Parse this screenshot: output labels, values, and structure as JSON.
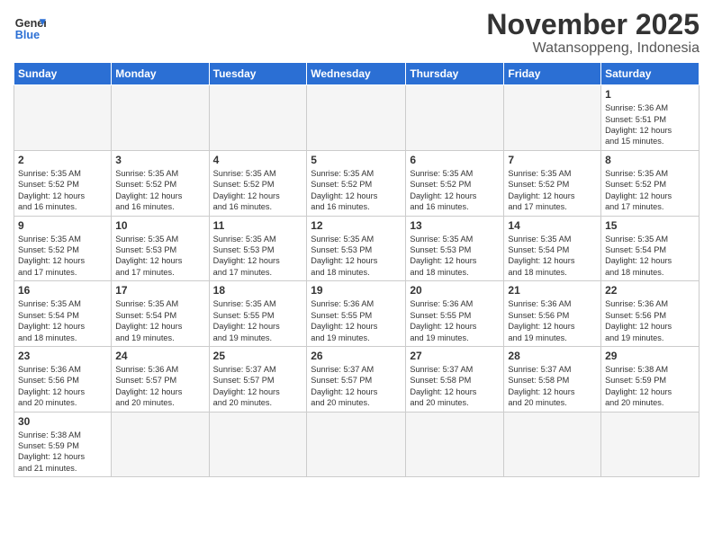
{
  "logo": {
    "line1": "General",
    "line2": "Blue"
  },
  "title": "November 2025",
  "subtitle": "Watansoppeng, Indonesia",
  "days_of_week": [
    "Sunday",
    "Monday",
    "Tuesday",
    "Wednesday",
    "Thursday",
    "Friday",
    "Saturday"
  ],
  "weeks": [
    [
      {
        "day": "",
        "info": ""
      },
      {
        "day": "",
        "info": ""
      },
      {
        "day": "",
        "info": ""
      },
      {
        "day": "",
        "info": ""
      },
      {
        "day": "",
        "info": ""
      },
      {
        "day": "",
        "info": ""
      },
      {
        "day": "1",
        "info": "Sunrise: 5:36 AM\nSunset: 5:51 PM\nDaylight: 12 hours\nand 15 minutes."
      }
    ],
    [
      {
        "day": "2",
        "info": "Sunrise: 5:35 AM\nSunset: 5:52 PM\nDaylight: 12 hours\nand 16 minutes."
      },
      {
        "day": "3",
        "info": "Sunrise: 5:35 AM\nSunset: 5:52 PM\nDaylight: 12 hours\nand 16 minutes."
      },
      {
        "day": "4",
        "info": "Sunrise: 5:35 AM\nSunset: 5:52 PM\nDaylight: 12 hours\nand 16 minutes."
      },
      {
        "day": "5",
        "info": "Sunrise: 5:35 AM\nSunset: 5:52 PM\nDaylight: 12 hours\nand 16 minutes."
      },
      {
        "day": "6",
        "info": "Sunrise: 5:35 AM\nSunset: 5:52 PM\nDaylight: 12 hours\nand 16 minutes."
      },
      {
        "day": "7",
        "info": "Sunrise: 5:35 AM\nSunset: 5:52 PM\nDaylight: 12 hours\nand 17 minutes."
      },
      {
        "day": "8",
        "info": "Sunrise: 5:35 AM\nSunset: 5:52 PM\nDaylight: 12 hours\nand 17 minutes."
      }
    ],
    [
      {
        "day": "9",
        "info": "Sunrise: 5:35 AM\nSunset: 5:52 PM\nDaylight: 12 hours\nand 17 minutes."
      },
      {
        "day": "10",
        "info": "Sunrise: 5:35 AM\nSunset: 5:53 PM\nDaylight: 12 hours\nand 17 minutes."
      },
      {
        "day": "11",
        "info": "Sunrise: 5:35 AM\nSunset: 5:53 PM\nDaylight: 12 hours\nand 17 minutes."
      },
      {
        "day": "12",
        "info": "Sunrise: 5:35 AM\nSunset: 5:53 PM\nDaylight: 12 hours\nand 18 minutes."
      },
      {
        "day": "13",
        "info": "Sunrise: 5:35 AM\nSunset: 5:53 PM\nDaylight: 12 hours\nand 18 minutes."
      },
      {
        "day": "14",
        "info": "Sunrise: 5:35 AM\nSunset: 5:54 PM\nDaylight: 12 hours\nand 18 minutes."
      },
      {
        "day": "15",
        "info": "Sunrise: 5:35 AM\nSunset: 5:54 PM\nDaylight: 12 hours\nand 18 minutes."
      }
    ],
    [
      {
        "day": "16",
        "info": "Sunrise: 5:35 AM\nSunset: 5:54 PM\nDaylight: 12 hours\nand 18 minutes."
      },
      {
        "day": "17",
        "info": "Sunrise: 5:35 AM\nSunset: 5:54 PM\nDaylight: 12 hours\nand 19 minutes."
      },
      {
        "day": "18",
        "info": "Sunrise: 5:35 AM\nSunset: 5:55 PM\nDaylight: 12 hours\nand 19 minutes."
      },
      {
        "day": "19",
        "info": "Sunrise: 5:36 AM\nSunset: 5:55 PM\nDaylight: 12 hours\nand 19 minutes."
      },
      {
        "day": "20",
        "info": "Sunrise: 5:36 AM\nSunset: 5:55 PM\nDaylight: 12 hours\nand 19 minutes."
      },
      {
        "day": "21",
        "info": "Sunrise: 5:36 AM\nSunset: 5:56 PM\nDaylight: 12 hours\nand 19 minutes."
      },
      {
        "day": "22",
        "info": "Sunrise: 5:36 AM\nSunset: 5:56 PM\nDaylight: 12 hours\nand 19 minutes."
      }
    ],
    [
      {
        "day": "23",
        "info": "Sunrise: 5:36 AM\nSunset: 5:56 PM\nDaylight: 12 hours\nand 20 minutes."
      },
      {
        "day": "24",
        "info": "Sunrise: 5:36 AM\nSunset: 5:57 PM\nDaylight: 12 hours\nand 20 minutes."
      },
      {
        "day": "25",
        "info": "Sunrise: 5:37 AM\nSunset: 5:57 PM\nDaylight: 12 hours\nand 20 minutes."
      },
      {
        "day": "26",
        "info": "Sunrise: 5:37 AM\nSunset: 5:57 PM\nDaylight: 12 hours\nand 20 minutes."
      },
      {
        "day": "27",
        "info": "Sunrise: 5:37 AM\nSunset: 5:58 PM\nDaylight: 12 hours\nand 20 minutes."
      },
      {
        "day": "28",
        "info": "Sunrise: 5:37 AM\nSunset: 5:58 PM\nDaylight: 12 hours\nand 20 minutes."
      },
      {
        "day": "29",
        "info": "Sunrise: 5:38 AM\nSunset: 5:59 PM\nDaylight: 12 hours\nand 20 minutes."
      }
    ],
    [
      {
        "day": "30",
        "info": "Sunrise: 5:38 AM\nSunset: 5:59 PM\nDaylight: 12 hours\nand 21 minutes."
      },
      {
        "day": "",
        "info": ""
      },
      {
        "day": "",
        "info": ""
      },
      {
        "day": "",
        "info": ""
      },
      {
        "day": "",
        "info": ""
      },
      {
        "day": "",
        "info": ""
      },
      {
        "day": "",
        "info": ""
      }
    ]
  ]
}
